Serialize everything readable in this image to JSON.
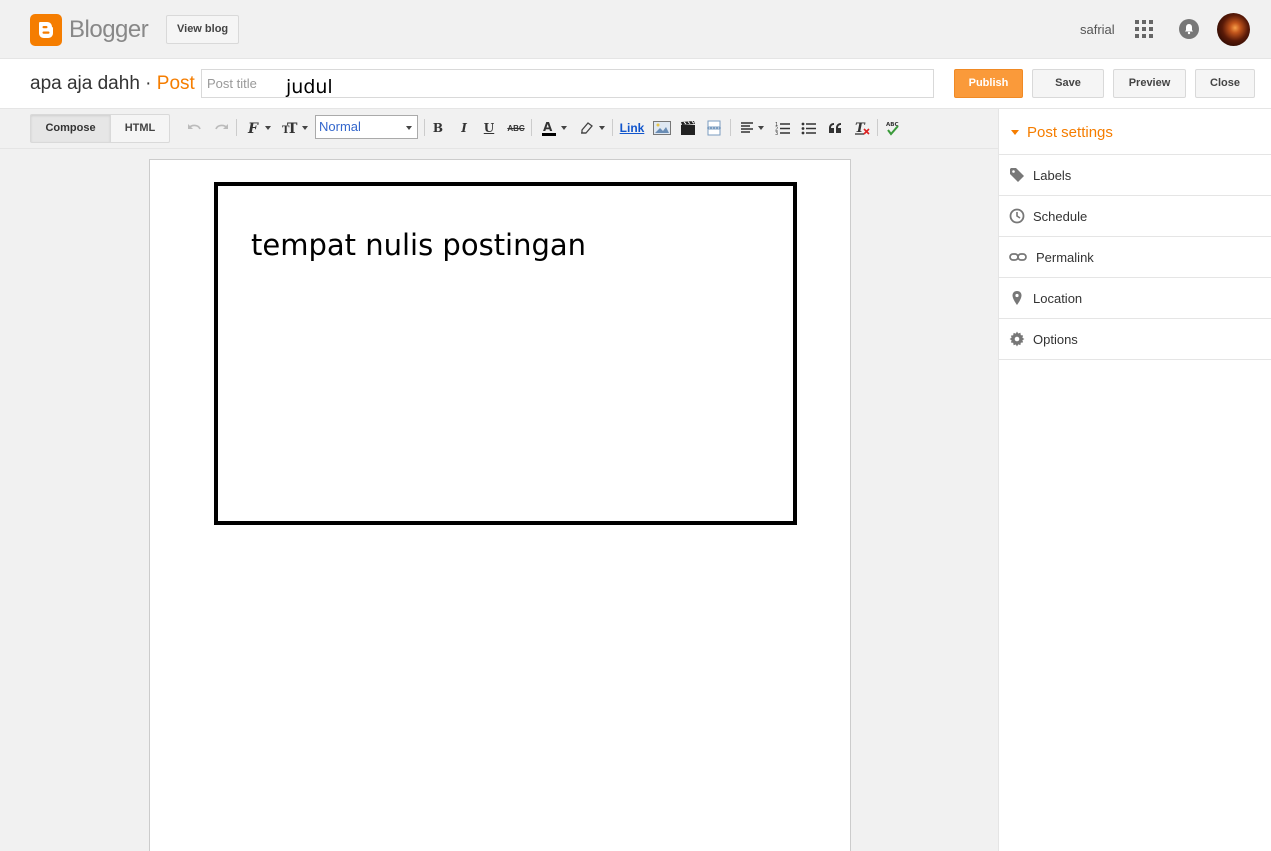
{
  "header": {
    "logo_text": "Blogger",
    "view_blog_label": "View blog",
    "user_name": "safrial"
  },
  "titlebar": {
    "blog_name": "apa aja dahh",
    "separator": "·",
    "section": "Post",
    "title_placeholder": "Post title",
    "typed_title": "judul",
    "publish_label": "Publish",
    "save_label": "Save",
    "preview_label": "Preview",
    "close_label": "Close"
  },
  "toolbar": {
    "compose_label": "Compose",
    "html_label": "HTML",
    "format_value": "Normal",
    "bold_glyph": "B",
    "italic_glyph": "I",
    "underline_glyph": "U",
    "strike_glyph": "ABC",
    "link_label": "Link",
    "spellcheck_glyph": "ABC"
  },
  "editor": {
    "annotation_text": "tempat nulis postingan"
  },
  "sidebar": {
    "heading": "Post settings",
    "items": [
      {
        "label": "Labels",
        "icon": "tag-icon"
      },
      {
        "label": "Schedule",
        "icon": "clock-icon"
      },
      {
        "label": "Permalink",
        "icon": "link-icon"
      },
      {
        "label": "Location",
        "icon": "pin-icon"
      },
      {
        "label": "Options",
        "icon": "gear-icon"
      }
    ]
  },
  "colors": {
    "accent": "#f57d00",
    "publish_bg": "#fa9a3a",
    "link": "#1155cc"
  }
}
